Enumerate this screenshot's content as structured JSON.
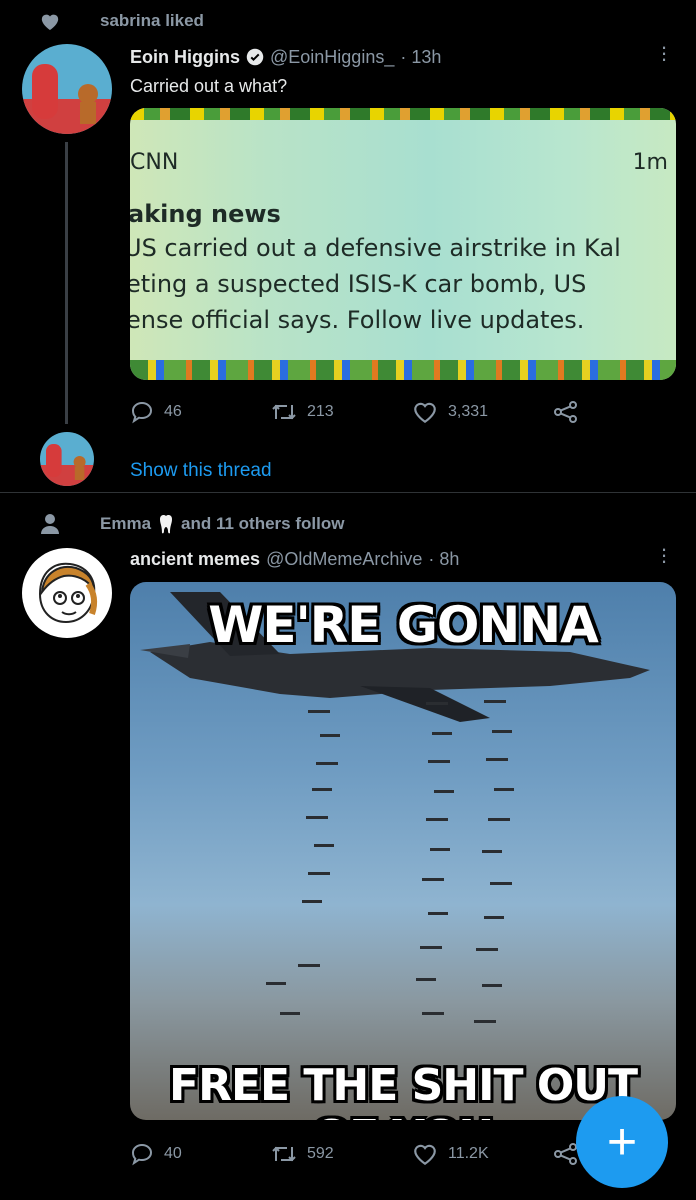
{
  "tweet1": {
    "context": "sabrina liked",
    "author_name": "Eoin Higgins",
    "author_handle": "@EoinHiggins_",
    "time": "· 13h",
    "text": "Carried out a what?",
    "embed": {
      "source": "CNN",
      "age": "1m",
      "heading": "aking news",
      "lines": [
        "US carried out a defensive airstrike in Kal",
        "eting a suspected ISIS-K car bomb, US",
        "ense official says. Follow live updates."
      ]
    },
    "replies": "46",
    "retweets": "213",
    "likes": "3,331",
    "show_thread": "Show this thread"
  },
  "tweet2": {
    "context_prefix": "Emma",
    "context_suffix": "and 11 others follow",
    "author_name": "ancient memes",
    "author_handle": "@OldMemeArchive",
    "time": "· 8h",
    "meme_top": "WE'RE GONNA",
    "meme_bottom": "FREE THE SHIT OUT OF YOU",
    "replies": "40",
    "retweets": "592",
    "likes": "11.2K"
  },
  "fab_label": "+",
  "colors": {
    "accent": "#1d9bf0",
    "background": "#000000",
    "muted": "#8b98a5",
    "verified": "#e7e9ea"
  }
}
